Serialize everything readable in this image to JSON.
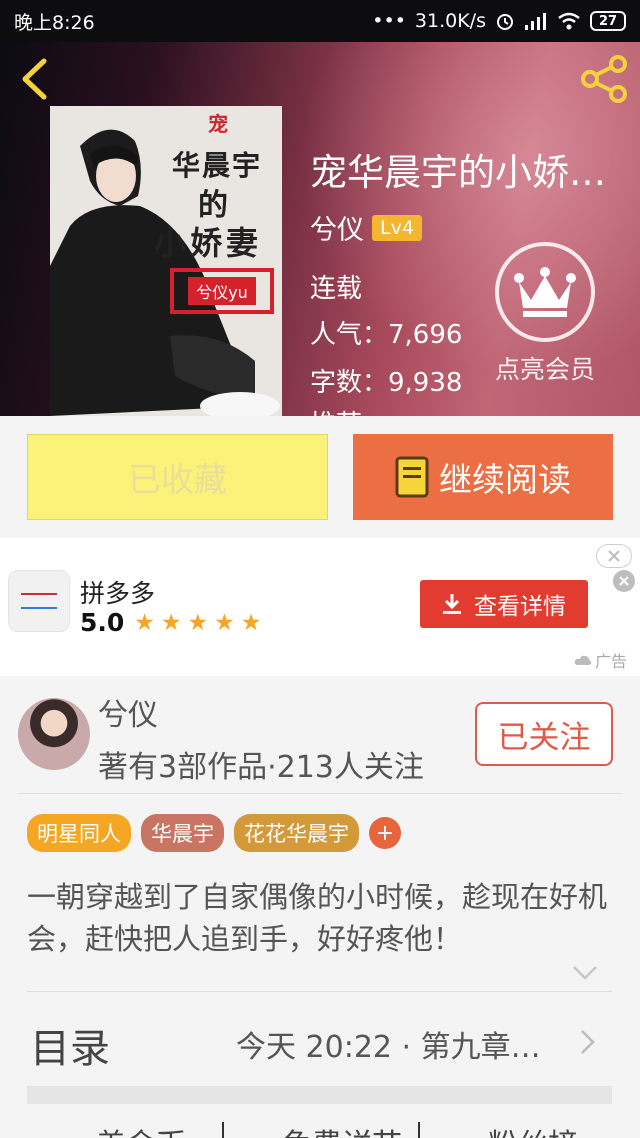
{
  "status_bar": {
    "time": "晚上8:26",
    "network_speed": "31.0K/s",
    "battery": "27"
  },
  "book": {
    "title": "宠华晨宇的小娇…",
    "author": "兮仪",
    "level": "Lv4",
    "status": "连载",
    "popularity": "人气：7,696",
    "word_count": "字数：9,938",
    "extra_partial": "推荐"
  },
  "cover": {
    "mark": "宠",
    "line1": "华晨宇",
    "line2": "的",
    "line3": "小娇妻",
    "author_tag": "兮仪yu"
  },
  "vip": {
    "label": "点亮会员"
  },
  "actions": {
    "collected_label": "已收藏",
    "read_label": "继续阅读"
  },
  "ad": {
    "app_name": "拼多多",
    "rating": "5.0",
    "stars": 5,
    "button_label": "查看详情",
    "tag": "广告",
    "colors": {
      "button": "#e23b30",
      "stars": "#f5a623"
    }
  },
  "author_card": {
    "name": "兮仪",
    "stats": "著有3部作品·213人关注",
    "follow_label": "已关注",
    "tags": [
      {
        "label": "明星同人",
        "color": "#f5a623"
      },
      {
        "label": "华晨宇",
        "color": "#c97563"
      },
      {
        "label": "花花华晨宇",
        "color": "#d39a3c"
      }
    ],
    "tag_add": "+",
    "description": "一朝穿越到了自家偶像的小时候，趁现在好机会，赶快把人追到手，好好疼他！"
  },
  "toc": {
    "label": "目录",
    "latest": "今天 20:22 · 第九章…"
  },
  "bottom_tabs": [
    "盖金币",
    "免费详节",
    "粉丝榜"
  ]
}
